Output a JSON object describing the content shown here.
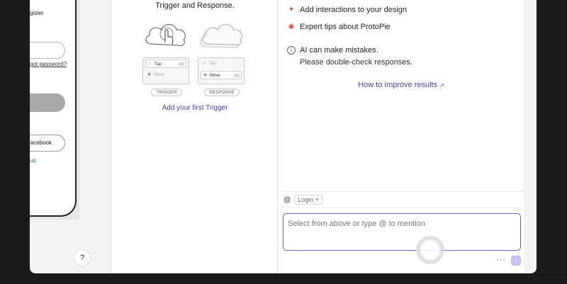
{
  "phone": {
    "register_label": "gister",
    "forgot_password": "got password?",
    "facebook_label": "Facebook",
    "signup_label": "up"
  },
  "help": {
    "label": "?"
  },
  "interactions": {
    "intro_text": "Trigger and Response.",
    "trigger_card": {
      "row1": "Tap",
      "row2": "Move",
      "tag": "TRIGGER"
    },
    "response_card": {
      "row1": "Tap",
      "row2": "Move",
      "tag": "RESPONSE"
    },
    "add_trigger_link": "Add your first Trigger"
  },
  "ai_panel": {
    "items": [
      {
        "icon": "sparkle-icon",
        "label": "Add interactions to your design"
      },
      {
        "icon": "lightbulb-icon",
        "label": "Expert tips about ProtoPie"
      }
    ],
    "warning": {
      "icon": "info-icon",
      "title": "AI can make mistakes.",
      "subtitle": "Please double-check responses."
    },
    "improve_link": "How to improve results",
    "mention": {
      "at": "@",
      "chip": "Login +"
    },
    "input_placeholder": "Select from above or type @ to mention",
    "more_label": "···",
    "send_label": "↑"
  },
  "colors": {
    "accent": "#4a3f9b",
    "input_border": "#6b5fc7",
    "send_bg": "#c9bff2"
  }
}
